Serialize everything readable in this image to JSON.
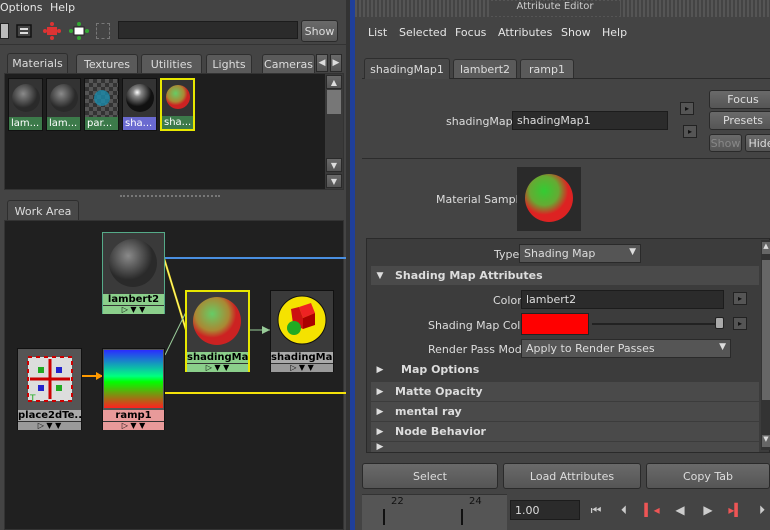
{
  "colors": {
    "accent_blue": "#4a8fe0",
    "connection_yellow": "#f5e20a",
    "panel_dark": "#202020",
    "divider": "#1f3f9a",
    "shading_map_color": "#ff0000"
  },
  "left": {
    "menu": {
      "options": "Options",
      "help": "Help"
    },
    "toolbar": {
      "show_label": "Show",
      "icons": [
        "graph-icon",
        "layout-icon",
        "input-output-icon",
        "output-connections-icon",
        "clear-icon"
      ]
    },
    "tabs": [
      {
        "label": "Materials"
      },
      {
        "label": "Textures"
      },
      {
        "label": "Utilities"
      },
      {
        "label": "Lights"
      },
      {
        "label": "Cameras"
      }
    ],
    "swatches": [
      {
        "label": "lam..."
      },
      {
        "label": "lam..."
      },
      {
        "label": "par..."
      },
      {
        "label": "sha..."
      },
      {
        "label": "sha..."
      }
    ],
    "work_area_tab": "Work Area",
    "nodes": {
      "lambert2": "lambert2",
      "shading1": "shadingMa...",
      "shading2": "shadingMa...",
      "place2d": "place2dTe...",
      "ramp1": "ramp1"
    }
  },
  "right": {
    "title": "Attribute Editor",
    "menu": [
      {
        "label": "List"
      },
      {
        "label": "Selected"
      },
      {
        "label": "Focus"
      },
      {
        "label": "Attributes"
      },
      {
        "label": "Show"
      },
      {
        "label": "Help"
      }
    ],
    "tabs": [
      {
        "label": "shadingMap1"
      },
      {
        "label": "lambert2"
      },
      {
        "label": "ramp1"
      }
    ],
    "name_label": "shadingMap:",
    "name_value": "shadingMap1",
    "focus": "Focus",
    "presets": "Presets",
    "show": "Show",
    "hide": "Hide",
    "material_sample": "Material Sample",
    "type_label": "Type",
    "type_value": "Shading Map",
    "section_main": "Shading Map Attributes",
    "color_label": "Color",
    "color_value": "lambert2",
    "shading_map_color_label": "Shading Map Color",
    "render_pass_label": "Render Pass Mode",
    "render_pass_value": "Apply to Render Passes",
    "sections": [
      {
        "label": "Map Options"
      },
      {
        "label": "Matte Opacity"
      },
      {
        "label": "mental ray"
      },
      {
        "label": "Node Behavior"
      }
    ],
    "buttons": {
      "select": "Select",
      "load": "Load Attributes",
      "copy": "Copy Tab"
    }
  },
  "timeline": {
    "tick_22": "22",
    "tick_24": "24",
    "current_time": "1.00"
  }
}
